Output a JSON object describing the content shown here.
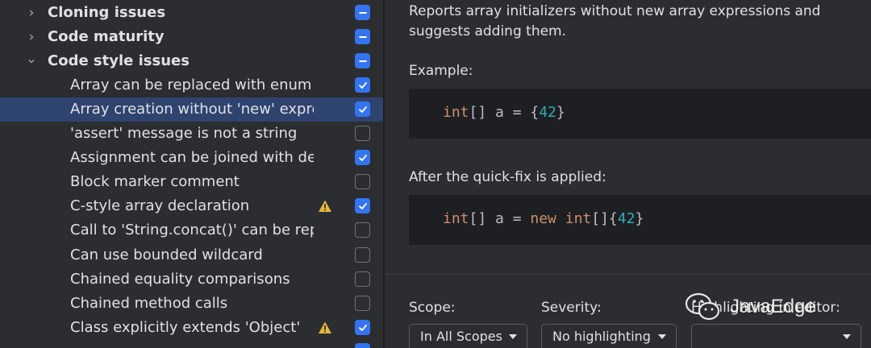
{
  "tree": {
    "groups": [
      {
        "label": "Cloning issues",
        "expanded": false,
        "state": "partial"
      },
      {
        "label": "Code maturity",
        "expanded": false,
        "state": "partial"
      },
      {
        "label": "Code style issues",
        "expanded": true,
        "state": "partial"
      }
    ],
    "items": [
      {
        "label": "Array can be replaced with enum v",
        "checked": true,
        "warning": false,
        "selected": false
      },
      {
        "label": "Array creation without 'new' expre",
        "checked": true,
        "warning": false,
        "selected": true
      },
      {
        "label": "'assert' message is not a string",
        "checked": false,
        "warning": false,
        "selected": false
      },
      {
        "label": "Assignment can be joined with dec",
        "checked": true,
        "warning": false,
        "selected": false
      },
      {
        "label": "Block marker comment",
        "checked": false,
        "warning": false,
        "selected": false
      },
      {
        "label": "C-style array declaration",
        "checked": true,
        "warning": true,
        "selected": false
      },
      {
        "label": "Call to 'String.concat()' can be rep",
        "checked": false,
        "warning": false,
        "selected": false
      },
      {
        "label": "Can use bounded wildcard",
        "checked": false,
        "warning": false,
        "selected": false
      },
      {
        "label": "Chained equality comparisons",
        "checked": false,
        "warning": false,
        "selected": false
      },
      {
        "label": "Chained method calls",
        "checked": false,
        "warning": false,
        "selected": false
      },
      {
        "label": "Class explicitly extends 'Object'",
        "checked": true,
        "warning": true,
        "selected": false
      }
    ]
  },
  "details": {
    "description": "Reports array initializers without new array expressions and suggests adding them.",
    "example_label": "Example:",
    "example_code": {
      "type_kw": "int",
      "rest1": "[] a = {",
      "num": "42",
      "rest2": "}"
    },
    "after_label": "After the quick-fix is applied:",
    "after_code": {
      "type_kw": "int",
      "rest1": "[] a = ",
      "new_kw": "new",
      "space": " ",
      "type_kw2": "int",
      "rest2": "[]{",
      "num": "42",
      "rest3": "}"
    }
  },
  "options": {
    "scope_label": "Scope:",
    "scope_value": "In All Scopes",
    "severity_label": "Severity:",
    "severity_value": "No highlighting (w",
    "highlighting_label": "Highlighting in editor:",
    "highlighting_value": ""
  },
  "watermark": {
    "text": "JavaEdge"
  },
  "colors": {
    "accent": "#3574f0",
    "selection": "#2e436e",
    "keyword": "#cf8e6d",
    "number": "#2aacb8",
    "warning": "#e5b93a"
  }
}
